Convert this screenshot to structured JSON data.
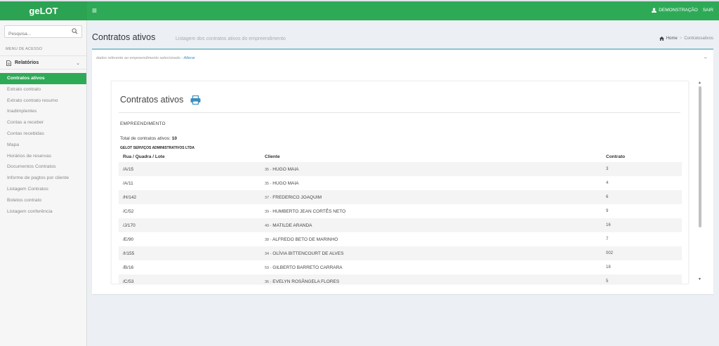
{
  "app": {
    "brand": "geLOT"
  },
  "topbar": {
    "user_label": "DEMONSTRAÇÃO",
    "logout_label": "SAIR"
  },
  "sidebar": {
    "search_placeholder": "Pesquisa...",
    "menu_header": "MENU DE ACESSO",
    "group_label": "Relatórios",
    "items": [
      {
        "label": "Contratos ativos",
        "active": true
      },
      {
        "label": "Extrato contrato"
      },
      {
        "label": "Extrato contrato resumo"
      },
      {
        "label": "Inadimplentes"
      },
      {
        "label": "Contas a receber"
      },
      {
        "label": "Contas recebidas"
      },
      {
        "label": "Mapa"
      },
      {
        "label": "Horários de reservas"
      },
      {
        "label": "Documentos Contratos"
      },
      {
        "label": "Informe de pagtos por cliente"
      },
      {
        "label": "Listagem Contratos"
      },
      {
        "label": "Boletos contrato"
      },
      {
        "label": "Listagem conferência"
      }
    ]
  },
  "header": {
    "title": "Contratos ativos",
    "subtitle": "Listagem dos contratos ativos do empreendimento",
    "breadcrumb": {
      "home": "Home",
      "separator": ">",
      "current": "Contratosativos"
    }
  },
  "box": {
    "note": "dados referente ao empreendimento selecionado -",
    "note_link": "Alterar",
    "collapse": "−"
  },
  "report": {
    "title": "Contratos ativos",
    "section_label": "EMPREENDIMENTO",
    "total_label": "Total de contratos ativos:",
    "total_value": "10",
    "company": "GELOT SERVIÇOS ADMINISTRATIVOS LTDA",
    "columns": [
      "Rua / Quadra / Lote",
      "Cliente",
      "Contrato"
    ],
    "rows": [
      {
        "lote": "/A/15",
        "client_id": "35 -",
        "client_name": "HUGO MAIA",
        "contrato": "3"
      },
      {
        "lote": "/A/11",
        "client_id": "35 -",
        "client_name": "HUGO MAIA",
        "contrato": "4"
      },
      {
        "lote": "/H/142",
        "client_id": "37 -",
        "client_name": "FREDERICO JOAQUIM",
        "contrato": "6"
      },
      {
        "lote": "/C/52",
        "client_id": "39 -",
        "client_name": "HUMBERTO JEAN CORTÊS NETO",
        "contrato": "9"
      },
      {
        "lote": "/J/170",
        "client_id": "49 -",
        "client_name": "MATILDE ARANDA",
        "contrato": "16"
      },
      {
        "lote": "/E/90",
        "client_id": "38 -",
        "client_name": "ALFREDO BETO DE MARINHO",
        "contrato": "7"
      },
      {
        "lote": "/I/155",
        "client_id": "34 -",
        "client_name": "OLÍVIA BITTENCOURT DE ALVES",
        "contrato": "002"
      },
      {
        "lote": "/B/16",
        "client_id": "59 -",
        "client_name": "GILBERTO BARRETO CARRARA",
        "contrato": "18"
      },
      {
        "lote": "/C/53",
        "client_id": "36 -",
        "client_name": "EVELYN ROSÂNGELA FLORES",
        "contrato": "5"
      }
    ]
  },
  "colors": {
    "brand_green": "#2eaa57",
    "accent_blue": "#3c8dbc",
    "box_top": "#8bc4d1"
  },
  "icons": [
    "menu-icon",
    "user-icon",
    "search-icon",
    "document-icon",
    "chevron-down-icon",
    "home-icon",
    "printer-icon",
    "minus-icon"
  ]
}
